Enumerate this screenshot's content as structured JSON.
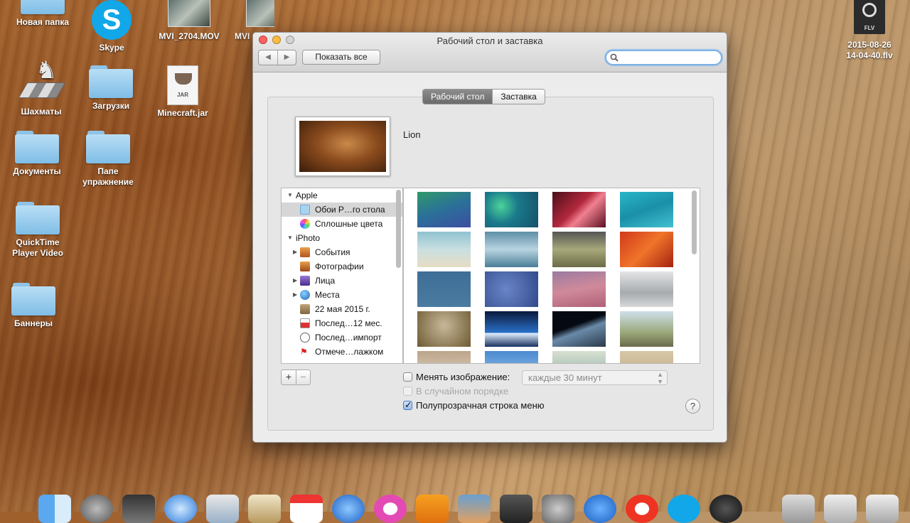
{
  "desktop": {
    "icons": [
      {
        "label": "Новая папка"
      },
      {
        "label": "Skype"
      },
      {
        "label": "MVI_2704.MOV"
      },
      {
        "label": "MVI"
      },
      {
        "label": "Шахматы"
      },
      {
        "label": "Загрузки"
      },
      {
        "label": "Minecraft.jar",
        "badge": "JAR"
      },
      {
        "label": "Документы"
      },
      {
        "label": "Папе упражнение"
      },
      {
        "label": "QuickTime Player Video"
      },
      {
        "label": "Баннеры"
      },
      {
        "label": "2015-08-26 14-04-40.flv",
        "badge": "FLV"
      }
    ]
  },
  "window": {
    "title": "Рабочий стол и заставка",
    "show_all": "Показать все",
    "search": {
      "value": "",
      "placeholder": ""
    },
    "tabs": [
      {
        "label": "Рабочий стол",
        "selected": true
      },
      {
        "label": "Заставка",
        "selected": false
      }
    ],
    "current_picture": "Lion",
    "sources": [
      {
        "label": "Apple",
        "type": "group",
        "expanded": true
      },
      {
        "label": "Обои Р…го стола",
        "type": "item",
        "selected": true,
        "icon": "folder-icon"
      },
      {
        "label": "Сплошные цвета",
        "type": "item",
        "icon": "color-wheel-icon"
      },
      {
        "label": "iPhoto",
        "type": "group",
        "expanded": true
      },
      {
        "label": "События",
        "type": "item",
        "expandable": true,
        "icon": "events-icon"
      },
      {
        "label": "Фотографии",
        "type": "item",
        "icon": "photos-icon"
      },
      {
        "label": "Лица",
        "type": "item",
        "expandable": true,
        "icon": "faces-icon"
      },
      {
        "label": "Места",
        "type": "item",
        "expandable": true,
        "icon": "globe-icon"
      },
      {
        "label": "22 мая 2015 г.",
        "type": "item",
        "icon": "event-icon"
      },
      {
        "label": "Послед…12 мес.",
        "type": "item",
        "icon": "calendar-icon"
      },
      {
        "label": "Послед…импорт",
        "type": "item",
        "icon": "import-icon"
      },
      {
        "label": "Отмече…лажком",
        "type": "item",
        "icon": "flag-icon"
      }
    ],
    "change_picture_label": "Менять изображение:",
    "change_picture_checked": false,
    "interval": "каждые 30 минут",
    "random_order_label": "В случайном порядке",
    "random_order_enabled": false,
    "translucent_menu_label": "Полупрозрачная строка меню",
    "translucent_menu_checked": true,
    "plus": "+",
    "minus": "−",
    "help": "?"
  },
  "colors": {
    "accent": "#7ab2e8",
    "close": "#fc615d",
    "minimize": "#fdbc40"
  }
}
